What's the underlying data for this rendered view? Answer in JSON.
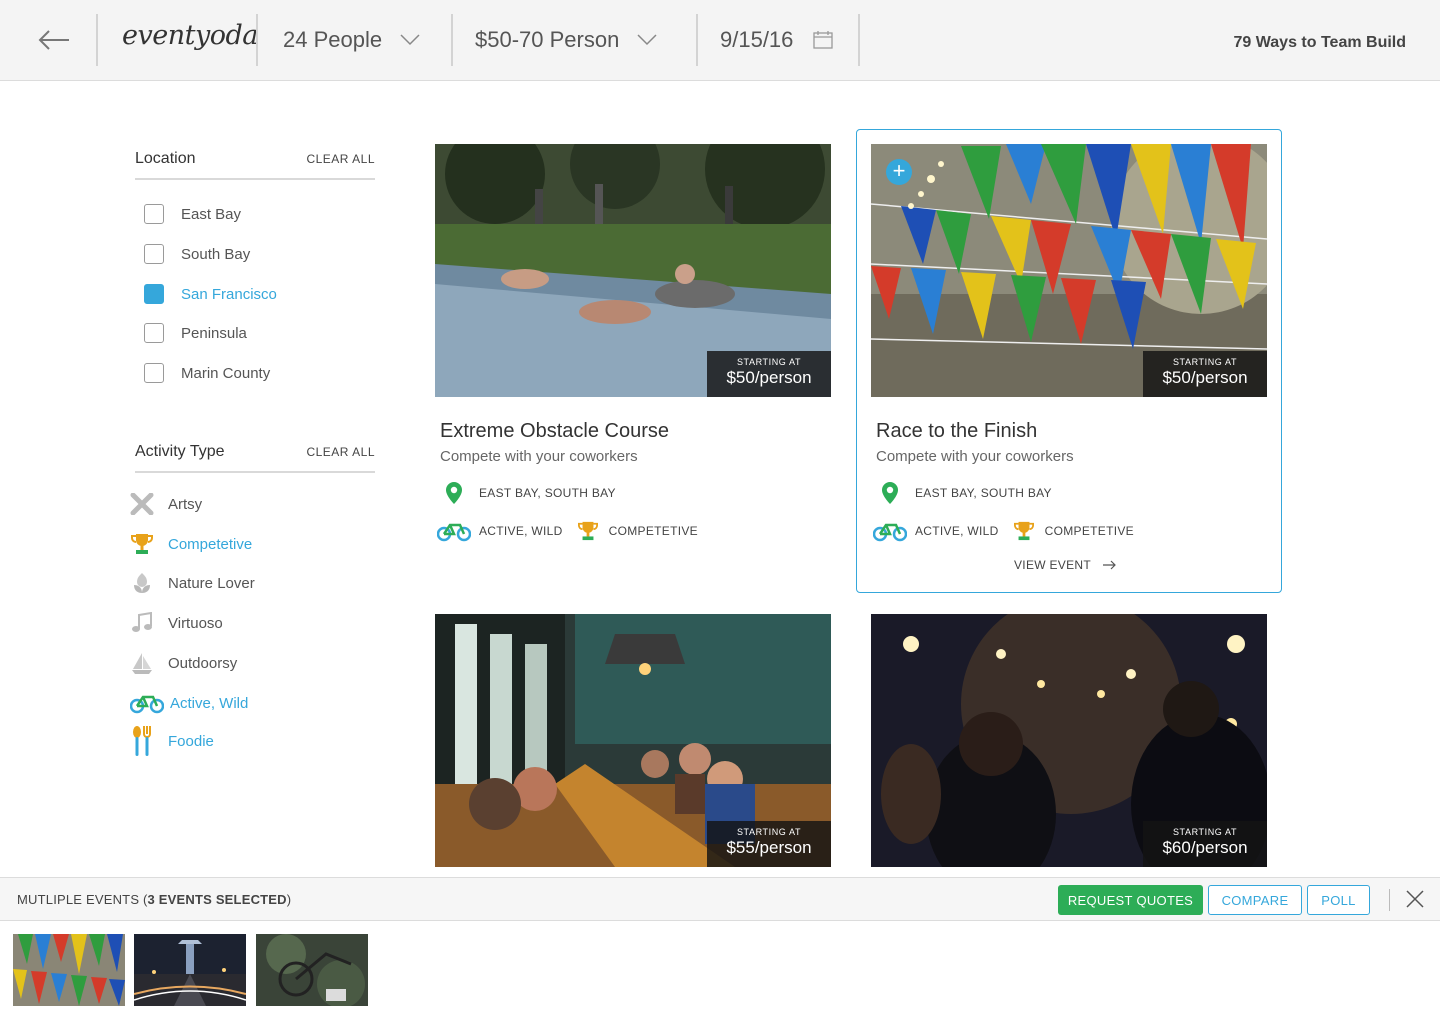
{
  "header": {
    "logo": "eventyoda",
    "people": "24 People",
    "price_range": "$50-70 Person",
    "date": "9/15/16",
    "right_title": "79 Ways to Team Build"
  },
  "sidebar": {
    "location": {
      "title": "Location",
      "clear": "CLEAR ALL",
      "items": [
        {
          "label": "East Bay",
          "checked": false
        },
        {
          "label": "South Bay",
          "checked": false
        },
        {
          "label": "San Francisco",
          "checked": true
        },
        {
          "label": "Peninsula",
          "checked": false
        },
        {
          "label": "Marin County",
          "checked": false
        }
      ]
    },
    "activity": {
      "title": "Activity Type",
      "clear": "CLEAR ALL",
      "items": [
        {
          "label": "Artsy",
          "icon": "artsy-icon",
          "active": false
        },
        {
          "label": "Competetive",
          "icon": "trophy-icon",
          "active": true
        },
        {
          "label": "Nature Lover",
          "icon": "flower-icon",
          "active": false
        },
        {
          "label": "Virtuoso",
          "icon": "music-note-icon",
          "active": false
        },
        {
          "label": "Outdoorsy",
          "icon": "sailboat-icon",
          "active": false
        },
        {
          "label": "Active, Wild",
          "icon": "bicycle-icon",
          "active": true
        },
        {
          "label": "Foodie",
          "icon": "fork-spoon-icon",
          "active": true
        }
      ]
    }
  },
  "cards": [
    {
      "title": "Extreme Obstacle Course",
      "subtitle": "Compete with your coworkers",
      "price_label": "STARTING AT",
      "price": "$50/person",
      "location": "EAST BAY, SOUTH BAY",
      "tag1": "ACTIVE, WILD",
      "tag2": "COMPETETIVE"
    },
    {
      "title": "Race to the Finish",
      "subtitle": "Compete with your coworkers",
      "price_label": "STARTING AT",
      "price": "$50/person",
      "location": "EAST BAY, SOUTH BAY",
      "tag1": "ACTIVE, WILD",
      "tag2": "COMPETETIVE",
      "view": "VIEW EVENT"
    },
    {
      "price_label": "STARTING AT",
      "price": "$55/person"
    },
    {
      "price_label": "STARTING AT",
      "price": "$60/person"
    }
  ],
  "bottom_bar": {
    "prefix": "MUTLIPLE EVENTS (",
    "count": "3 EVENTS SELECTED",
    "suffix": ")",
    "request": "REQUEST QUOTES",
    "compare": "COMPARE",
    "poll": "POLL"
  },
  "colors": {
    "accent": "#35a7db",
    "green": "#2dad57",
    "trophy": "#e8a21a"
  }
}
